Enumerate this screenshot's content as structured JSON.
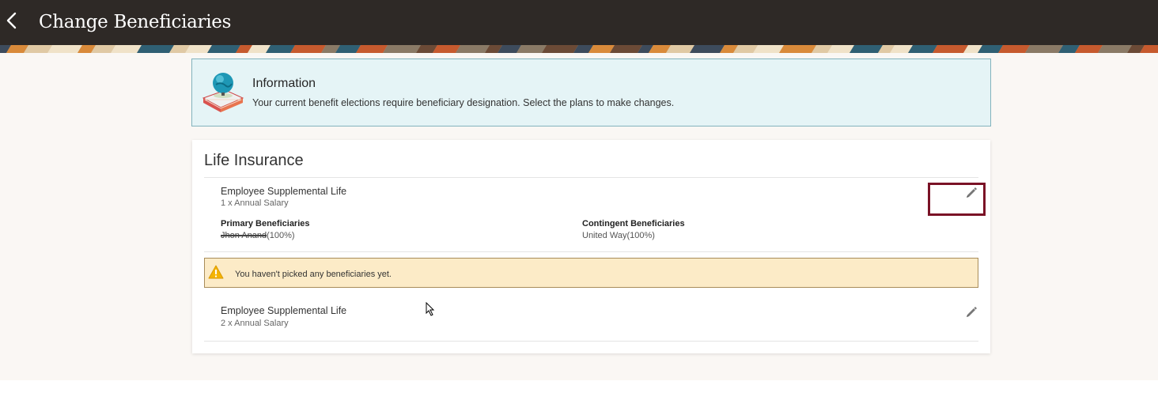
{
  "header": {
    "title": "Change Beneficiaries"
  },
  "info": {
    "title": "Information",
    "text": "Your current benefit elections require beneficiary designation. Select the plans to make changes."
  },
  "section": {
    "title": "Life Insurance",
    "plans": [
      {
        "name": "Employee Supplemental Life",
        "coverage": "1 x Annual Salary",
        "primary_label": "Primary Beneficiaries",
        "primary_name_redacted": "Jhon Anand",
        "primary_pct": "(100%)",
        "contingent_label": "Contingent Beneficiaries",
        "contingent_value": "United Way(100%)"
      },
      {
        "name": "Employee Supplemental Life",
        "coverage": "2 x Annual Salary"
      }
    ],
    "warning": "You haven't picked any beneficiaries yet."
  },
  "icons": {
    "back": "chevron-left-icon",
    "info": "globe-on-book-icon",
    "edit": "pencil-icon",
    "warning": "warning-triangle-icon"
  },
  "colors": {
    "header_bg": "#2e2926",
    "info_bg": "#e5f4f6",
    "warning_bg": "#fcebc7",
    "highlight_border": "#7a1226"
  }
}
